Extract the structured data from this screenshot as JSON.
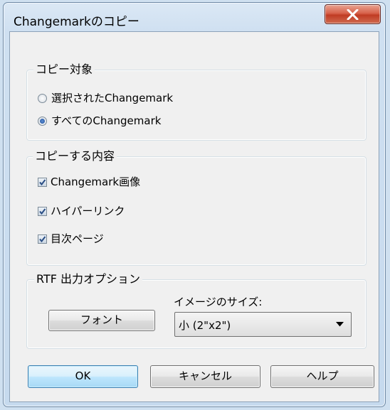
{
  "window": {
    "title": "Changemarkのコピー",
    "close_icon": "close-x-icon"
  },
  "copy_target": {
    "legend": "コピー対象",
    "options": [
      {
        "label": "選択されたChangemark",
        "checked": false
      },
      {
        "label": "すべてのChangemark",
        "checked": true
      }
    ]
  },
  "copy_content": {
    "legend": "コピーする内容",
    "items": [
      {
        "label": "Changemark画像",
        "checked": true
      },
      {
        "label": "ハイパーリンク",
        "checked": true
      },
      {
        "label": "目次ページ",
        "checked": true
      }
    ]
  },
  "rtf": {
    "legend": "RTF 出力オプション",
    "font_button": "フォント",
    "image_size_label": "イメージのサイズ:",
    "image_size_value": "小 (2\"x2\")"
  },
  "buttons": {
    "ok": "OK",
    "cancel": "キャンセル",
    "help": "ヘルプ"
  },
  "colors": {
    "close_button": "#c9452d",
    "default_button_border": "#3c7fb1"
  }
}
